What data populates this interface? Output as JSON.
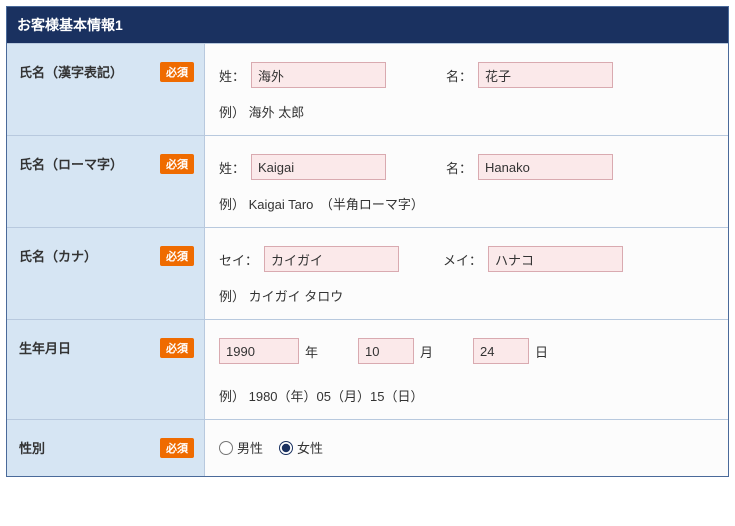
{
  "header": {
    "title": "お客様基本情報1"
  },
  "badges": {
    "required": "必須"
  },
  "rows": {
    "kanji": {
      "label": "氏名（漢字表記）",
      "sei_label": "姓：",
      "mei_label": "名：",
      "sei_value": "海外",
      "mei_value": "花子",
      "example": "例）  海外  太郎"
    },
    "roman": {
      "label": "氏名（ローマ字）",
      "sei_label": "姓：",
      "mei_label": "名：",
      "sei_value": "Kaigai",
      "mei_value": "Hanako",
      "example": "例）  Kaigai Taro　（半角ローマ字）"
    },
    "kana": {
      "label": "氏名（カナ）",
      "sei_label": "セイ：",
      "mei_label": "メイ：",
      "sei_value": "カイガイ",
      "mei_value": "ハナコ",
      "example": "例）  カイガイ   タロウ"
    },
    "dob": {
      "label": "生年月日",
      "year_value": "1990",
      "year_label": "年",
      "month_value": "10",
      "month_label": "月",
      "day_value": "24",
      "day_label": "日",
      "example": "例）  1980（年）05（月）15（日）"
    },
    "gender": {
      "label": "性別",
      "male": "男性",
      "female": "女性",
      "selected": "female"
    }
  }
}
